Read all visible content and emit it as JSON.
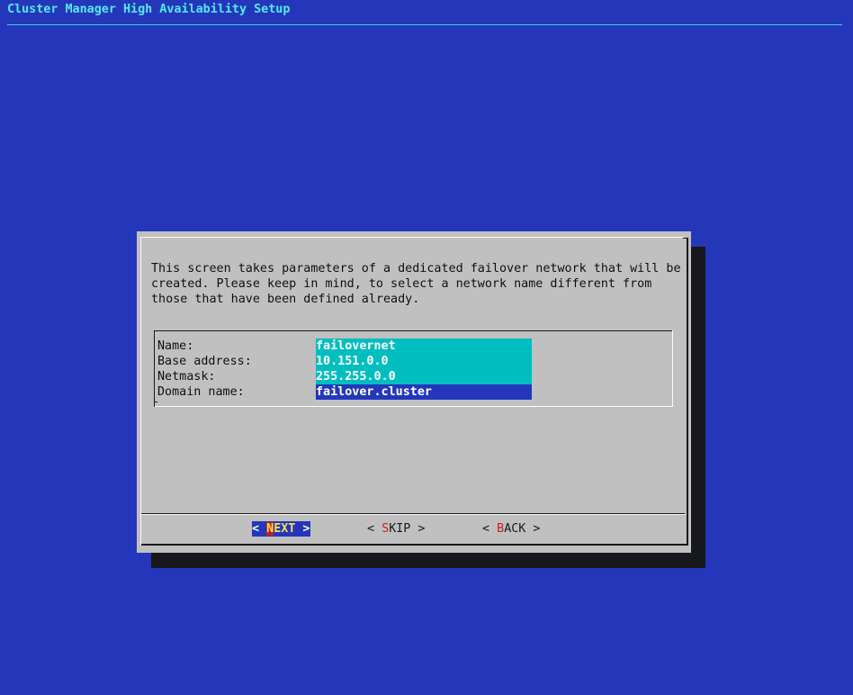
{
  "backtitle": "Cluster Manager High Availability Setup",
  "dialog": {
    "description": [
      "This screen takes parameters of a dedicated failover network that will be",
      "created. Please keep in mind, to select a network name different from",
      "those that have been defined already."
    ],
    "fields": [
      {
        "label": "Name:",
        "value": "failovernet"
      },
      {
        "label": "Base address:",
        "value": "10.151.0.0"
      },
      {
        "label": "Netmask:",
        "value": "255.255.0.0"
      },
      {
        "label": "Domain name:",
        "value": "failover.cluster"
      }
    ],
    "buttons": {
      "next": {
        "open": "< ",
        "hotkey": "N",
        "rest": "EXT",
        "close": " >"
      },
      "skip": {
        "open": "< ",
        "hotkey": "S",
        "rest": "KIP",
        "close": " >"
      },
      "back": {
        "open": "< ",
        "hotkey": "B",
        "rest": "ACK",
        "close": " >"
      }
    }
  },
  "colors": {
    "background": "#2437bb",
    "title_text": "#55e9f2",
    "dialog_bg": "#c0c0c0",
    "field_bg": "#00bec0",
    "hotkey": "#c81e1e"
  }
}
